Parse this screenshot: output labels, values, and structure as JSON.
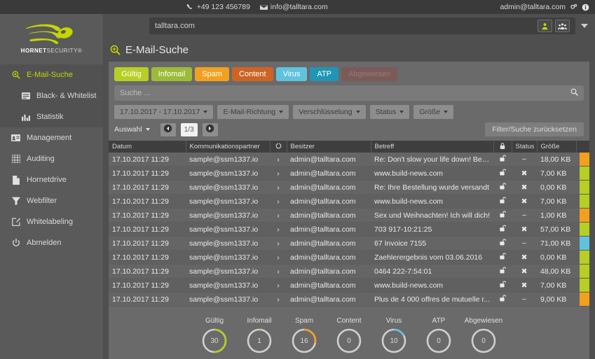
{
  "topbar": {
    "phone": "+49 123 456789",
    "email": "info@talltara.com",
    "account": "admin@talltara.com",
    "icons": [
      "phone-icon",
      "envelope-icon",
      "settings-gears-icon",
      "info-icon"
    ]
  },
  "brandbar": {
    "domain_value": "talltara.com",
    "user_button": "user-icon",
    "group_button": "user-group-icon",
    "dropdown": "chevron-down-icon"
  },
  "sidebar": {
    "logo_primary": "HORNET",
    "logo_secondary": "SECURITY",
    "logo_mark": "hornet-logo-icon",
    "items": [
      {
        "label": "E-Mail-Suche",
        "icon": "search-plus-icon",
        "active": true,
        "sub": false
      },
      {
        "label": "Black- & Whitelist",
        "icon": "list-icon",
        "active": false,
        "sub": true
      },
      {
        "label": "Statistik",
        "icon": "bar-chart-icon",
        "active": false,
        "sub": true
      },
      {
        "label": "Management",
        "icon": "id-card-icon",
        "active": false,
        "sub": false
      },
      {
        "label": "Auditing",
        "icon": "grid-table-icon",
        "active": false,
        "sub": false
      },
      {
        "label": "Hornetdrive",
        "icon": "file-icon",
        "active": false,
        "sub": false
      },
      {
        "label": "Webfilter",
        "icon": "filter-icon",
        "active": false,
        "sub": false
      },
      {
        "label": "Whitelabeling",
        "icon": "pencil-square-icon",
        "active": false,
        "sub": false
      },
      {
        "label": "Abmelden",
        "icon": "power-icon",
        "active": false,
        "sub": false
      }
    ]
  },
  "page": {
    "title": "E-Mail-Suche",
    "title_icon": "search-plus-icon"
  },
  "tabs": [
    {
      "label": "Gültig",
      "color": "#b7ce23",
      "disabled": false
    },
    {
      "label": "Infomail",
      "color": "#9dbb38",
      "disabled": false
    },
    {
      "label": "Spam",
      "color": "#f2a01e",
      "disabled": false
    },
    {
      "label": "Content",
      "color": "#cf6324",
      "disabled": false
    },
    {
      "label": "Virus",
      "color": "#5fc3dd",
      "disabled": false
    },
    {
      "label": "ATP",
      "color": "#2095b5",
      "disabled": false
    },
    {
      "label": "Abgewiesen",
      "color": "#7c5a57",
      "disabled": true
    }
  ],
  "search": {
    "placeholder": "Suche ...",
    "value": "",
    "icon": "search-icon"
  },
  "filters": [
    {
      "label": "17.10.2017 - 17.10.2017",
      "name": "date-range-filter"
    },
    {
      "label": "E-Mail-Richtung",
      "name": "mail-direction-filter"
    },
    {
      "label": "Verschlüsselung",
      "name": "encryption-filter"
    },
    {
      "label": "Status",
      "name": "status-filter"
    },
    {
      "label": "Größe",
      "name": "size-filter"
    }
  ],
  "actions": {
    "selection_label": "Auswahl",
    "prev_icon": "chevron-left-circle-icon",
    "page_indicator": "1/3",
    "next_icon": "chevron-right-circle-icon",
    "reset_label": "Filter/Suche zurücksetzen"
  },
  "table": {
    "columns": [
      {
        "label": "Datum",
        "name": "col-date"
      },
      {
        "label": "Kommunikationspartner",
        "name": "col-partner"
      },
      {
        "label": "",
        "name": "col-direction",
        "icon": "direction-icon"
      },
      {
        "label": "Besitzer",
        "name": "col-owner"
      },
      {
        "label": "Betreff",
        "name": "col-subject"
      },
      {
        "label": "",
        "name": "col-encryption",
        "icon": "lock-icon"
      },
      {
        "label": "Status",
        "name": "col-status"
      },
      {
        "label": "Größe",
        "name": "col-size"
      },
      {
        "label": "",
        "name": "col-action"
      }
    ],
    "rows": [
      {
        "date": "17.10.2017 11:29",
        "partner": "sample@ssm1337.io",
        "dir": "›",
        "owner": "admin@talltara.com",
        "subject": "Re: Don't slow your life down! Be a...",
        "lock": "unlock-icon",
        "status": "−",
        "size": "18,00 KB",
        "bar": "#f2a01e"
      },
      {
        "date": "17.10.2017 11:29",
        "partner": "sample@ssm1337.io",
        "dir": "›",
        "owner": "admin@talltara.com",
        "subject": "www.build-news.com",
        "lock": "unlock-icon",
        "status": "✖",
        "size": "7,00 KB",
        "bar": "#b7ce23"
      },
      {
        "date": "17.10.2017 11:29",
        "partner": "sample@ssm1337.io",
        "dir": "›",
        "owner": "admin@talltara.com",
        "subject": "Re: Ihre Bestellung wurde versandt",
        "lock": "unlock-icon",
        "status": "✖",
        "size": "0,00 KB",
        "bar": "#b7ce23"
      },
      {
        "date": "17.10.2017 11:29",
        "partner": "sample@ssm1337.io",
        "dir": "›",
        "owner": "admin@talltara.com",
        "subject": "www.build-news.com",
        "lock": "unlock-icon",
        "status": "✖",
        "size": "7,00 KB",
        "bar": "#b7ce23"
      },
      {
        "date": "17.10.2017 11:29",
        "partner": "sample@ssm1337.io",
        "dir": "›",
        "owner": "admin@talltara.com",
        "subject": "Sex und Weihnachten! Ich will dich!",
        "lock": "unlock-icon",
        "status": "−",
        "size": "1,00 KB",
        "bar": "#f2a01e"
      },
      {
        "date": "17.10.2017 11:29",
        "partner": "sample@ssm1337.io",
        "dir": "›",
        "owner": "admin@talltara.com",
        "subject": "703 917-10:21:25",
        "lock": "unlock-icon",
        "status": "✖",
        "size": "57,00 KB",
        "bar": "#b7ce23"
      },
      {
        "date": "17.10.2017 11:29",
        "partner": "sample@ssm1337.io",
        "dir": "›",
        "owner": "admin@talltara.com",
        "subject": "67 Invoice 7155",
        "lock": "unlock-icon",
        "status": "−",
        "size": "71,00 KB",
        "bar": "#5fc3dd"
      },
      {
        "date": "17.10.2017 11:29",
        "partner": "sample@ssm1337.io",
        "dir": "›",
        "owner": "admin@talltara.com",
        "subject": "Zaehlerergebnis vom 03.06.2016",
        "lock": "unlock-icon",
        "status": "✖",
        "size": "0,00 KB",
        "bar": "#b7ce23"
      },
      {
        "date": "17.10.2017 11:29",
        "partner": "sample@ssm1337.io",
        "dir": "›",
        "owner": "admin@talltara.com",
        "subject": "0464 222-7:54:01",
        "lock": "unlock-icon",
        "status": "✖",
        "size": "48,00 KB",
        "bar": "#b7ce23"
      },
      {
        "date": "17.10.2017 11:29",
        "partner": "sample@ssm1337.io",
        "dir": "›",
        "owner": "admin@talltara.com",
        "subject": "www.build-news.com",
        "lock": "unlock-icon",
        "status": "✖",
        "size": "7,00 KB",
        "bar": "#b7ce23"
      },
      {
        "date": "17.10.2017 11:29",
        "partner": "sample@ssm1337.io",
        "dir": "›",
        "owner": "admin@talltara.com",
        "subject": "Plus de 4 000 offres de mutuelle r...",
        "lock": "unlock-icon",
        "status": "−",
        "size": "9,00 KB",
        "bar": "#f2a01e"
      }
    ]
  },
  "chart_data": {
    "type": "pie",
    "title": "",
    "categories": [
      "Gültig",
      "Infomail",
      "Spam",
      "Content",
      "Virus",
      "ATP",
      "Abgewiesen"
    ],
    "values": [
      30,
      1,
      16,
      0,
      10,
      0,
      0
    ],
    "colors": [
      "#b7ce23",
      "#b7ce23",
      "#f2a01e",
      "#cf6324",
      "#5fc3dd",
      "#2095b5",
      "#7c5a57"
    ],
    "fractions": [
      0.51,
      0.02,
      0.28,
      0.0,
      0.17,
      0.0,
      0.0
    ],
    "track_color": "#cfcfcf",
    "legend": "above-each-donut",
    "note": "seven donut gauges showing message counts per classification"
  }
}
